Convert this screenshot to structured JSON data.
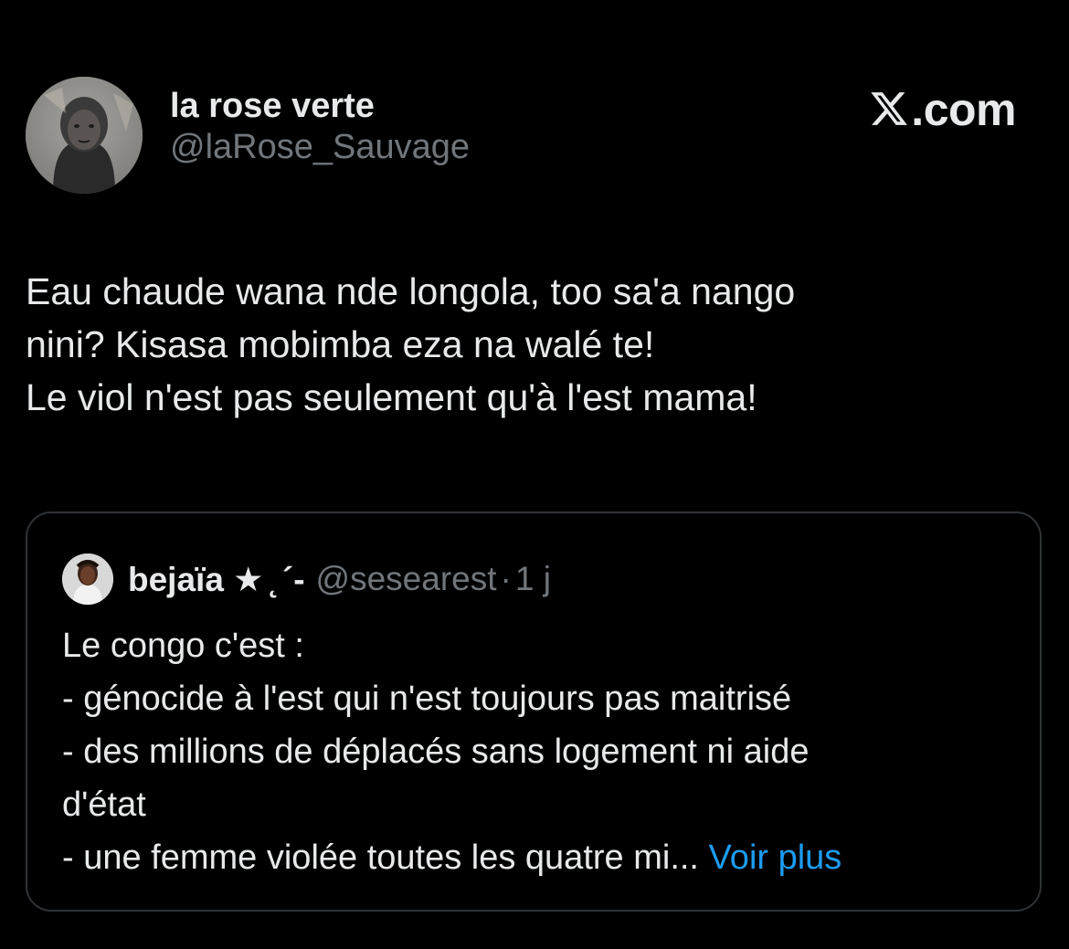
{
  "author": {
    "display_name": "la rose verte",
    "handle": "@laRose_Sauvage",
    "avatar_icon": "profile-photo-icon"
  },
  "brand": {
    "label": ".com",
    "logo_icon": "x-logo-icon"
  },
  "tweet": {
    "lines": [
      "Eau chaude wana nde longola, too sa'a nango",
      "nini? Kisasa mobimba eza na walé te!",
      "Le viol n'est pas seulement qu'à l'est mama!"
    ]
  },
  "quoted_tweet": {
    "display_name": "bejaïa ★ ̨ ´-",
    "handle": "@sesearest",
    "separator": "·",
    "time": "1 j",
    "avatar_icon": "profile-photo-icon",
    "lines": [
      "Le congo c'est :",
      "- génocide à l'est qui n'est toujours pas maitrisé",
      "- des millions de déplacés sans logement ni aide",
      "d'état"
    ],
    "last_line": "- une femme violée toutes les quatre mi...",
    "more_label": " Voir plus"
  },
  "colors": {
    "background": "#000000",
    "text_primary": "#e7e9ea",
    "text_secondary": "#71767b",
    "link": "#1d9bf0",
    "border": "#2f3336"
  }
}
